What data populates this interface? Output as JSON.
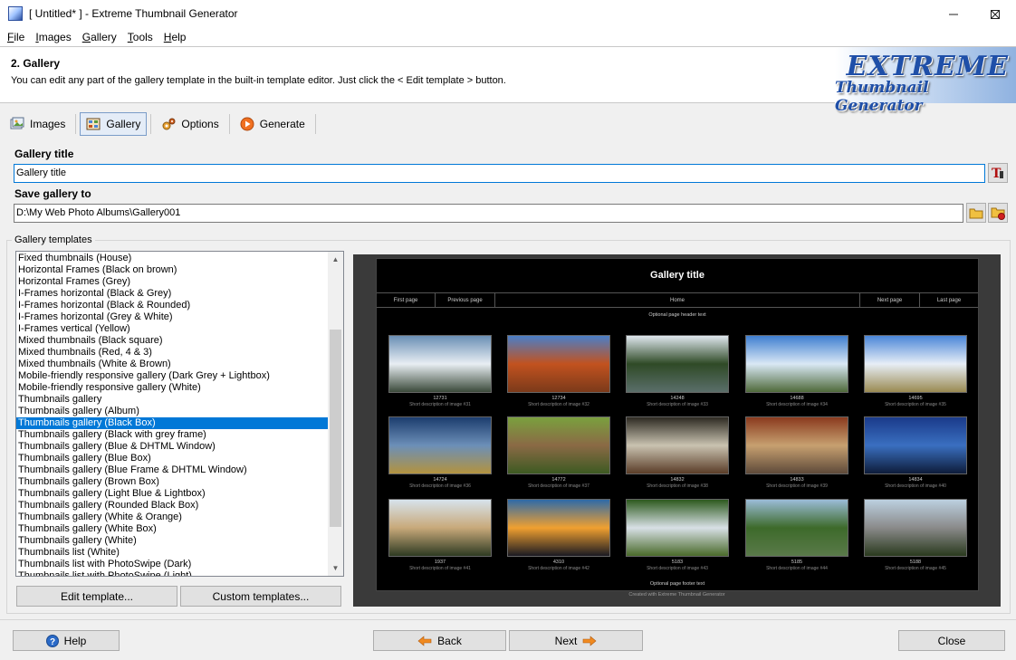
{
  "window": {
    "title": "[ Untitled* ] - Extreme Thumbnail Generator",
    "app_icon": "thumbnail-generator-icon"
  },
  "menu": [
    {
      "key": "F",
      "rest": "ile"
    },
    {
      "key": "I",
      "rest": "mages"
    },
    {
      "key": "G",
      "rest": "allery"
    },
    {
      "key": "T",
      "rest": "ools"
    },
    {
      "key": "H",
      "rest": "elp"
    }
  ],
  "header": {
    "step": "2. Gallery",
    "description": "You can edit any part of the gallery template in the built-in template editor. Just click the < Edit template > button.",
    "logo_line1": "EXTREME",
    "logo_line2": "Thumbnail Generator"
  },
  "tabs": [
    {
      "label": "Images",
      "icon": "images-icon"
    },
    {
      "label": "Gallery",
      "icon": "gallery-icon",
      "active": true
    },
    {
      "label": "Options",
      "icon": "options-icon"
    },
    {
      "label": "Generate",
      "icon": "generate-icon"
    }
  ],
  "form": {
    "gallery_title_label": "Gallery title",
    "gallery_title_value": "Gallery title",
    "save_to_label": "Save gallery to",
    "save_to_value": "D:\\My Web Photo Albums\\Gallery001"
  },
  "templates": {
    "group_label": "Gallery templates",
    "items": [
      "Fixed thumbnails (House)",
      "Horizontal Frames (Black on brown)",
      "Horizontal Frames (Grey)",
      "I-Frames horizontal (Black & Grey)",
      "I-Frames horizontal (Black & Rounded)",
      "I-Frames horizontal (Grey & White)",
      "I-Frames vertical (Yellow)",
      "Mixed thumbnails (Black square)",
      "Mixed thumbnails (Red, 4 & 3)",
      "Mixed thumbnails (White & Brown)",
      "Mobile-friendly responsive gallery (Dark Grey + Lightbox)",
      "Mobile-friendly responsive gallery (White)",
      "Thumbnails gallery",
      "Thumbnails gallery (Album)",
      "Thumbnails gallery (Black Box)",
      "Thumbnails gallery (Black with grey frame)",
      "Thumbnails gallery (Blue & DHTML Window)",
      "Thumbnails gallery (Blue Box)",
      "Thumbnails gallery (Blue Frame & DHTML Window)",
      "Thumbnails gallery (Brown Box)",
      "Thumbnails gallery (Light Blue & Lightbox)",
      "Thumbnails gallery (Rounded Black Box)",
      "Thumbnails gallery (White & Orange)",
      "Thumbnails gallery (White Box)",
      "Thumbnails gallery (White)",
      "Thumbnails list (White)",
      "Thumbnails list with PhotoSwipe (Dark)",
      "Thumbnails list with PhotoSwipe (Light)"
    ],
    "selected_index": 14,
    "edit_button": "Edit template...",
    "custom_button": "Custom templates..."
  },
  "preview": {
    "title": "Gallery title",
    "nav": [
      "First page",
      "Previous page",
      "Home",
      "Next page",
      "Last page"
    ],
    "header_text": "Optional page header text",
    "footer_text": "Optional page footer text",
    "credit": "Created with Extreme Thumbnail Generator",
    "thumbnails": [
      {
        "num": "12731",
        "caption": "Short description of image #31",
        "colors": [
          "#6a8fb5",
          "#e8eef3",
          "#3b4a3a"
        ]
      },
      {
        "num": "12734",
        "caption": "Short description of image #32",
        "colors": [
          "#4a7fc8",
          "#c2521f",
          "#7b3a1a"
        ]
      },
      {
        "num": "14248",
        "caption": "Short description of image #33",
        "colors": [
          "#dfe7ee",
          "#2f4a26",
          "#5a6e6a"
        ]
      },
      {
        "num": "14688",
        "caption": "Short description of image #34",
        "colors": [
          "#3f7fd0",
          "#d9e8f5",
          "#4f6a3a"
        ]
      },
      {
        "num": "14695",
        "caption": "Short description of image #35",
        "colors": [
          "#4a86d8",
          "#e7eef6",
          "#9a8a52"
        ]
      },
      {
        "num": "14724",
        "caption": "Short description of image #36",
        "colors": [
          "#1c3d6e",
          "#6c8fb8",
          "#b3933f"
        ]
      },
      {
        "num": "14772",
        "caption": "Short description of image #37",
        "colors": [
          "#7aa03e",
          "#8a6a45",
          "#3d5a22"
        ]
      },
      {
        "num": "14832",
        "caption": "Short description of image #38",
        "colors": [
          "#2d2a22",
          "#c9c2b0",
          "#5a3d28"
        ]
      },
      {
        "num": "14833",
        "caption": "Short description of image #39",
        "colors": [
          "#8a3a1e",
          "#c7a070",
          "#5e4a3a"
        ]
      },
      {
        "num": "14834",
        "caption": "Short description of image #40",
        "colors": [
          "#1a3a8a",
          "#3a6fc0",
          "#0e1c3a"
        ]
      },
      {
        "num": "1937",
        "caption": "Short description of image #41",
        "colors": [
          "#d7e3ec",
          "#c8a97a",
          "#2e3a22"
        ]
      },
      {
        "num": "4310",
        "caption": "Short description of image #42",
        "colors": [
          "#2e6aa8",
          "#f0a030",
          "#1a1a22"
        ]
      },
      {
        "num": "5183",
        "caption": "Short description of image #43",
        "colors": [
          "#2d5a1e",
          "#d8e0e6",
          "#4a6a2a"
        ]
      },
      {
        "num": "5185",
        "caption": "Short description of image #44",
        "colors": [
          "#9bbcd8",
          "#3d6a2a",
          "#5a7a4a"
        ]
      },
      {
        "num": "5188",
        "caption": "Short description of image #45",
        "colors": [
          "#bcd0e0",
          "#8a8a8a",
          "#2a3a1e"
        ]
      }
    ]
  },
  "bottom": {
    "help": "Help",
    "back": "Back",
    "next": "Next",
    "close": "Close"
  }
}
